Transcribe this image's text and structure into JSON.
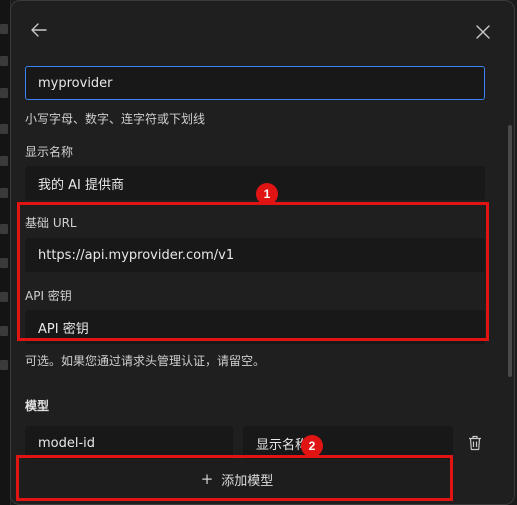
{
  "provider_id": {
    "value": "myprovider",
    "hint": "小写字母、数字、连字符或下划线"
  },
  "display_name": {
    "label": "显示名称",
    "value": "我的 AI 提供商"
  },
  "base_url": {
    "label": "基础 URL",
    "value": "https://api.myprovider.com/v1"
  },
  "api_key": {
    "label": "API 密钥",
    "placeholder": "API 密钥",
    "hint": "可选。如果您通过请求头管理认证，请留空。"
  },
  "models": {
    "label": "模型",
    "model_id_value": "model-id",
    "display_name_placeholder": "显示名称",
    "add_label": "添加模型"
  },
  "annotations": {
    "badge_1": "1",
    "badge_2": "2",
    "color": "#e11414"
  },
  "icons": {
    "back": "arrow-left-icon",
    "close": "close-icon",
    "delete": "trash-icon",
    "add": "plus-icon"
  },
  "colors": {
    "accent": "#3b82f6",
    "panel": "#1f1f1f",
    "field": "#181818"
  }
}
